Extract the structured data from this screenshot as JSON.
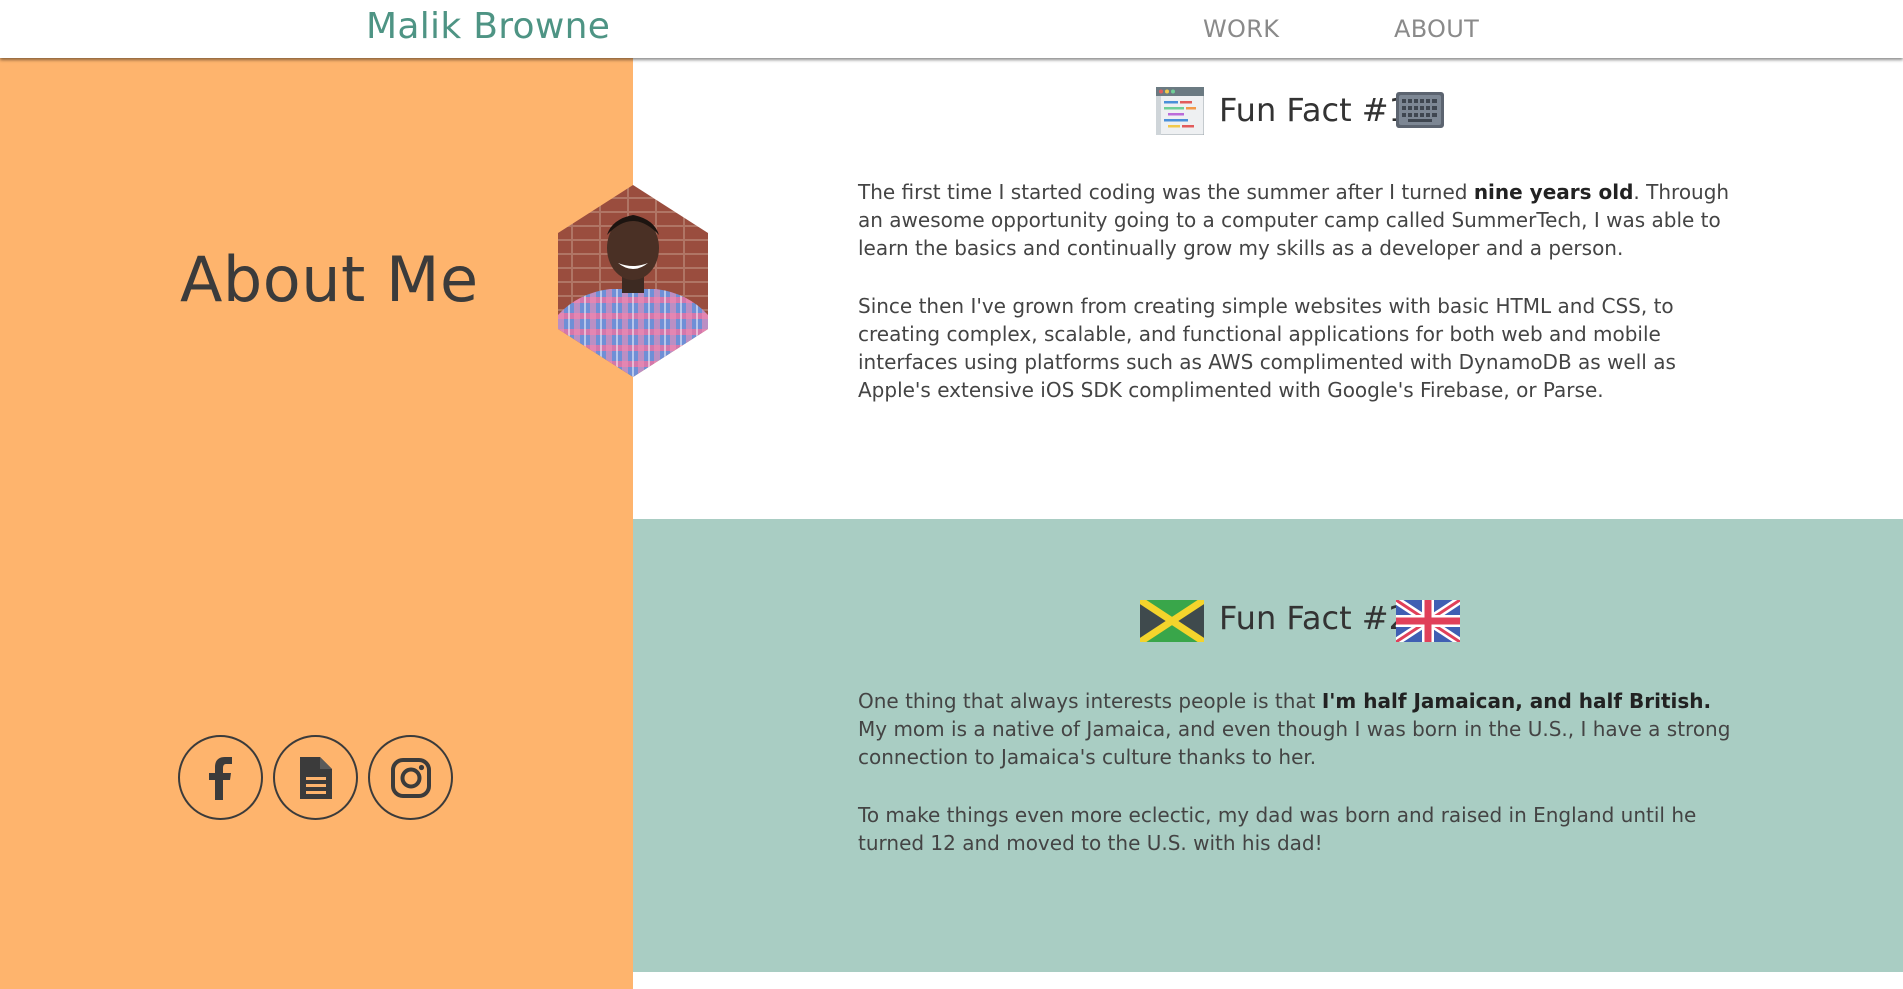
{
  "header": {
    "brand": "Malik Browne",
    "nav": {
      "work": "WORK",
      "about": "ABOUT"
    }
  },
  "about": {
    "title": "About Me",
    "social": [
      {
        "icon": "facebook-icon"
      },
      {
        "icon": "resume-document-icon"
      },
      {
        "icon": "instagram-icon"
      }
    ]
  },
  "fact1": {
    "title": "Fun Fact #1",
    "icons": [
      "code-window-icon",
      "keyboard-icon"
    ],
    "p1_a": "The first time I started coding was the summer after I turned ",
    "p1_b": "nine years old",
    "p1_c": ". Through an awesome opportunity going to a computer camp called SummerTech, I was able to learn the basics and continually grow my skills as a developer and a person.",
    "p2": "Since then I've grown from creating simple websites with basic HTML and CSS, to creating complex, scalable, and functional applications for both web and mobile interfaces using platforms such as AWS complimented with DynamoDB as well as Apple's extensive iOS SDK complimented with Google's Firebase, or Parse."
  },
  "fact2": {
    "title": "Fun Fact #2",
    "icons": [
      "jamaica-flag-icon",
      "uk-flag-icon"
    ],
    "p1_a": "One thing that always interests people is that ",
    "p1_b": "I'm half Jamaican, and half British.",
    "p1_c": " My mom is a native of Jamaica, and even though I was born in the U.S., I have a strong connection to Jamaica's culture thanks to her.",
    "p2": "To make things even more eclectic, my dad was born and raised in England until he turned 12 and moved to the U.S. with his dad!"
  },
  "colors": {
    "brand": "#4e9484",
    "left_panel": "#feb46d",
    "fact2_bg": "#a9cdc3",
    "text": "#3b3b3b"
  }
}
